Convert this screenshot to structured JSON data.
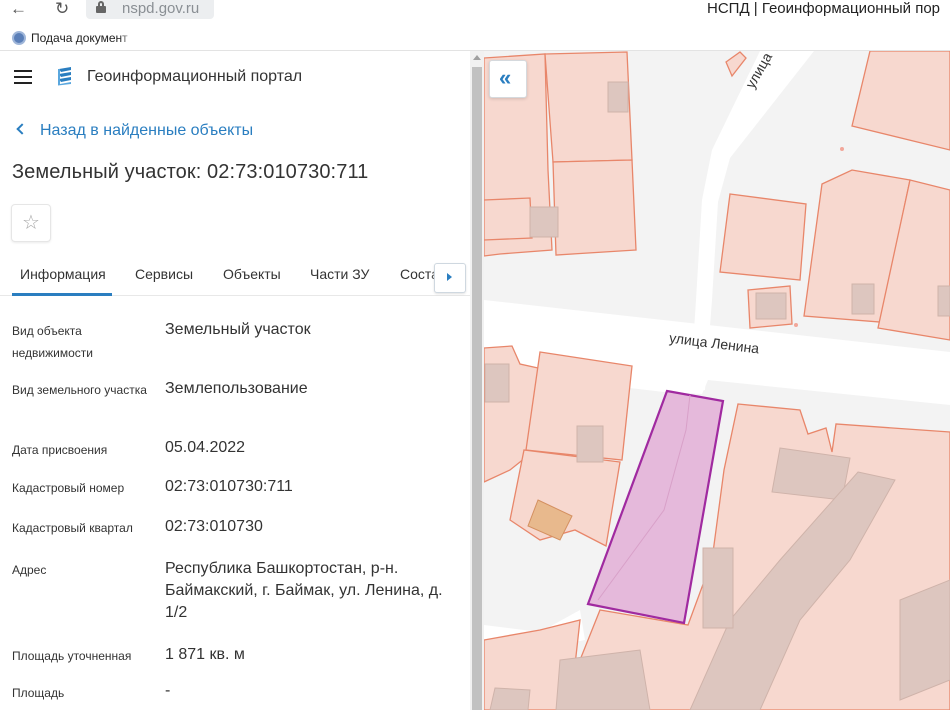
{
  "browser": {
    "back_glyph": "←",
    "reload_glyph": "↻",
    "url": "nspd.gov.ru",
    "page_title": "НСПД | Геоинформационный пор",
    "bookmark_label": "Подача документ"
  },
  "header": {
    "portal_title": "Геоинформационный портал"
  },
  "back_link": "Назад в найденные объекты",
  "object_title": "Земельный участок: 02:73:010730:711",
  "favorite_glyph": "☆",
  "tabs": [
    {
      "label": "Информация",
      "active": true
    },
    {
      "label": "Сервисы"
    },
    {
      "label": "Объекты"
    },
    {
      "label": "Части ЗУ"
    },
    {
      "label": "Соста"
    }
  ],
  "properties": [
    {
      "label": "Вид объекта недвижимости",
      "value": "Земельный участок"
    },
    {
      "label": "Вид земельного участка",
      "value": "Землепользование"
    },
    {
      "label": "Дата присвоения",
      "value": "05.04.2022"
    },
    {
      "label": "Кадастровый номер",
      "value": "02:73:010730:711"
    },
    {
      "label": "Кадастровый квартал",
      "value": "02:73:010730"
    },
    {
      "label": "Адрес",
      "value": "Республика Башкортостан, р-н. Баймакский, г. Баймак, ул. Ленина, д. 1/2"
    },
    {
      "label": "Площадь уточненная",
      "value": "1 871 кв. м"
    },
    {
      "label": "Площадь",
      "value": "-"
    }
  ],
  "map": {
    "collapse_glyph": "«",
    "street_lenina": "улица Ленина",
    "street_top": "улица",
    "colors": {
      "parcel_fill": "#f7d8cf",
      "parcel_stroke": "#e8866a",
      "building_fill": "#ddc6bf",
      "selected_fill": "#e3b2d8",
      "selected_stroke": "#a02aa0",
      "road": "#ffffff"
    }
  }
}
